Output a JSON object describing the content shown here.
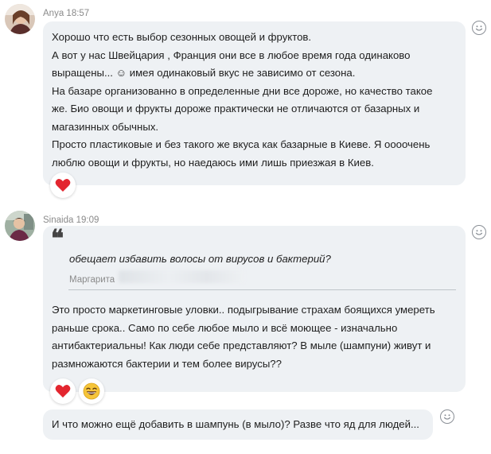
{
  "messages": [
    {
      "author": "Anya",
      "time": "18:57",
      "lines": [
        "Хорошо что есть выбор сезонных овощей и фруктов.",
        "А вот у нас Швейцария , Франция они все в любое время года одинаково",
        "выращены... ☺  имея одинаковый вкус не зависимо от сезона.",
        "На базаре организованно в определенные дни все дороже, но качество такое",
        "же. Био овощи и фрукты дороже практически не отличаются от базарных и",
        "магазинных обычных.",
        "Просто пластиковые и без такого же вкуса как базарные в Киеве. Я оооочень",
        "люблю овощи и фрукты, но наедаюсь ими лишь приезжая в Киев."
      ],
      "reactions": [
        "heart"
      ]
    },
    {
      "author": "Sinaida",
      "time": "19:09",
      "quote": {
        "text": "обещает избавить волосы от вирусов и бактерий?",
        "author": "Маргарита"
      },
      "lines": [
        "Это просто маркетинговые уловки.. подыгрывание страхам боящихся умереть",
        "раньше срока.. Само по себе любое мыло и всё моющее - изначально",
        "антибактериальны! Как люди себе представляют? В мыле (шампуни) живут и",
        "размножаются бактерии и тем более вирусы??"
      ],
      "reactions": [
        "heart",
        "laughing-face"
      ]
    },
    {
      "lines": [
        "И что можно ещё добавить в шампунь (в мыло)? Разве что яд для людей..."
      ]
    }
  ],
  "colors": {
    "bubble": "#eef1f4",
    "meta_text": "#8a8a8a",
    "heart": "#e3262f",
    "emoji_face": "#f6c53a"
  }
}
